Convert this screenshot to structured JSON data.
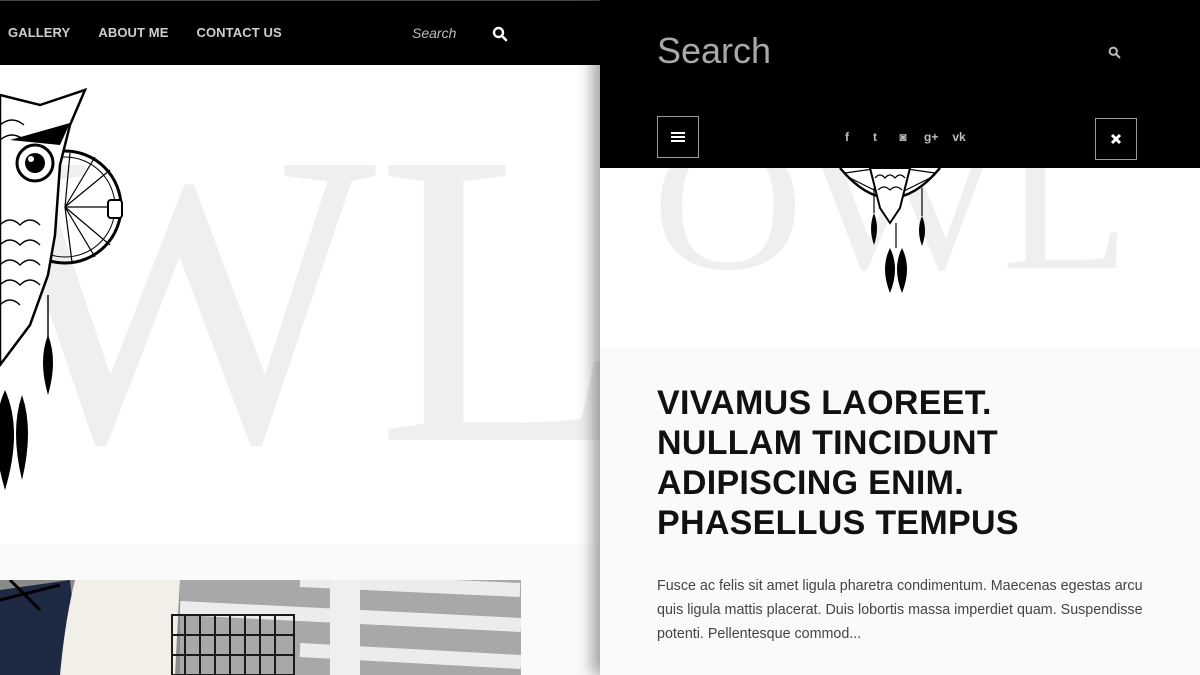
{
  "left_nav": {
    "items": [
      {
        "label": "GALLERY"
      },
      {
        "label": "ABOUT ME"
      },
      {
        "label": "CONTACT US"
      }
    ],
    "search_placeholder": "Search",
    "search_icon": "search-icon"
  },
  "hero": {
    "watermark_left": "WL",
    "watermark_right": "OWL",
    "art": "owl-dreamcatcher-illustration"
  },
  "mobile_panel": {
    "search_placeholder": "Search",
    "search_icon": "search-icon",
    "menu_icon": "hamburger-icon",
    "close_icon": "close-icon",
    "social": [
      {
        "icon": "facebook-icon",
        "glyph": "f"
      },
      {
        "icon": "twitter-icon",
        "glyph": "t"
      },
      {
        "icon": "instagram-icon",
        "glyph": "◙"
      },
      {
        "icon": "google-plus-icon",
        "glyph": "g+"
      },
      {
        "icon": "vk-icon",
        "glyph": "vk"
      }
    ]
  },
  "article": {
    "headline_lines": [
      "VIVAMUS LAOREET.",
      "NULLAM TINCIDUNT",
      "ADIPISCING ENIM.",
      "PHASELLUS TEMPUS"
    ],
    "excerpt": "Fusce ac felis sit amet ligula pharetra condimentum. Maecenas egestas arcu quis ligula mattis placerat. Duis lobortis massa imperdiet quam. Suspendisse potenti. Pellentesque commod..."
  },
  "colors": {
    "nav_bg": "#000000",
    "watermark": "#efefef",
    "text_dark": "#111111"
  }
}
